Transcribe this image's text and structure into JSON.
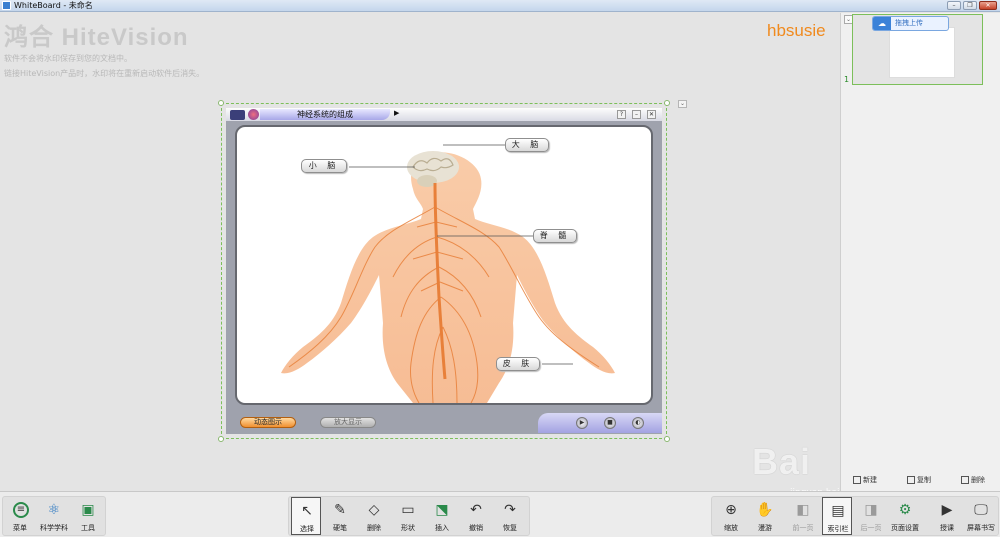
{
  "window": {
    "title": "WhiteBoard - 未命名",
    "min": "–",
    "max": "❐",
    "close": "✕"
  },
  "watermark": {
    "logo": "鸿合 HiteVision",
    "line1": "软件不会将水印保存到您的文档中。",
    "line2": "链接HiteVision产品时，水印将在重新启动软件后消失。"
  },
  "user": {
    "name": "hbsusie"
  },
  "flash": {
    "title": "神经系统的组成",
    "labels": {
      "cerebrum": "大 脑",
      "cerebellum": "小 脑",
      "spinal": "脊 髓",
      "skin": "皮 肤"
    },
    "btn_dynamic": "动态图示",
    "btn_zoom": "放大显示",
    "ctrl_help": "?",
    "ctrl_min": "–",
    "ctrl_close": "✕",
    "play": "▶",
    "stop": "■",
    "sound": "◐",
    "nav_arrow": "▶"
  },
  "pages": {
    "upload_label": "拖拽上传",
    "upload_icon": "cloud-upload-icon",
    "thumb_number": "1",
    "actions": {
      "new": "新建",
      "copy": "复制",
      "delete": "删除"
    }
  },
  "toolbar": {
    "left": [
      {
        "label": "菜单",
        "icon": "menu-icon"
      },
      {
        "label": "科学学科",
        "icon": "atom-icon"
      },
      {
        "label": "工具",
        "icon": "toolbox-icon"
      }
    ],
    "center": [
      {
        "label": "选择",
        "icon": "cursor-icon",
        "active": true
      },
      {
        "label": "硬笔",
        "icon": "pen-icon"
      },
      {
        "label": "删除",
        "icon": "eraser-icon"
      },
      {
        "label": "形状",
        "icon": "shape-icon"
      },
      {
        "label": "插入",
        "icon": "insert-icon"
      },
      {
        "label": "撤销",
        "icon": "undo-icon"
      },
      {
        "label": "恢复",
        "icon": "redo-icon"
      }
    ],
    "right": [
      {
        "label": "缩放",
        "icon": "zoom-icon"
      },
      {
        "label": "漫游",
        "icon": "hand-icon"
      },
      {
        "label": "前一页",
        "icon": "prev-page-icon",
        "disabled": true
      },
      {
        "label": "索引栏",
        "icon": "index-icon",
        "active": true
      },
      {
        "label": "后一页",
        "icon": "next-page-icon",
        "disabled": true
      },
      {
        "label": "页面设置",
        "icon": "page-settings-icon"
      },
      {
        "label": "授课",
        "icon": "teach-icon"
      },
      {
        "label": "屏幕书写",
        "icon": "screen-write-icon"
      }
    ]
  },
  "overlay": {
    "baidu": "Bai 经验",
    "baidu_sub": "jingyan.baidu.com"
  },
  "colors": {
    "accent_orange": "#f08a1e",
    "selection_green": "#7cbf5a",
    "nerve_orange": "#e8803a"
  }
}
